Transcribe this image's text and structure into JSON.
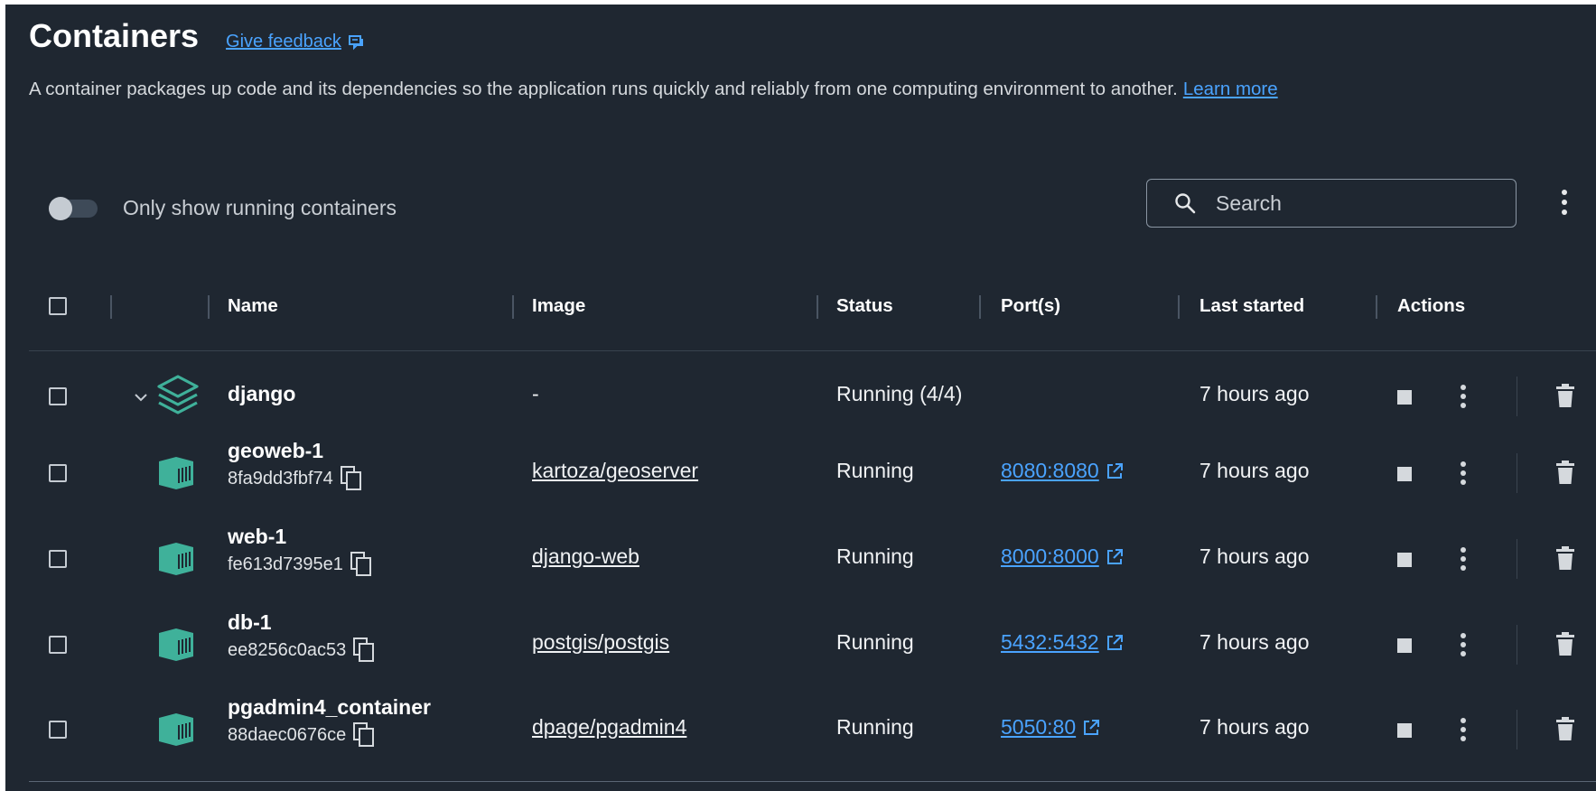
{
  "header": {
    "title": "Containers",
    "feedback_label": "Give feedback",
    "description": "A container packages up code and its dependencies so the application runs quickly and reliably from one computing environment to another.",
    "learn_more": "Learn more"
  },
  "filters": {
    "toggle_label": "Only show running containers",
    "toggle_on": false,
    "search_placeholder": "Search"
  },
  "columns": {
    "name": "Name",
    "image": "Image",
    "status": "Status",
    "ports": "Port(s)",
    "last_started": "Last started",
    "actions": "Actions"
  },
  "group": {
    "name": "django",
    "image": "-",
    "status": "Running (4/4)",
    "last_started": "7 hours ago"
  },
  "containers": [
    {
      "name": "geoweb-1",
      "id": "8fa9dd3fbf74",
      "image": "kartoza/geoserver",
      "status": "Running",
      "port": "8080:8080",
      "last_started": "7 hours ago"
    },
    {
      "name": "web-1",
      "id": "fe613d7395e1",
      "image": "django-web",
      "status": "Running",
      "port": "8000:8000",
      "last_started": "7 hours ago"
    },
    {
      "name": "db-1",
      "id": "ee8256c0ac53",
      "image": "postgis/postgis",
      "status": "Running",
      "port": "5432:5432",
      "last_started": "7 hours ago"
    },
    {
      "name": "pgadmin4_container",
      "id": "88daec0676ce",
      "image": "dpage/pgadmin4",
      "status": "Running",
      "port": "5050:80",
      "last_started": "7 hours ago"
    }
  ],
  "colors": {
    "background": "#1f2731",
    "link": "#4aa3ff",
    "container_icon": "#3fb19a"
  },
  "icons": {
    "feedback": "feedback-icon",
    "search": "search-icon",
    "more": "kebab-icon",
    "expand": "chevron-down-icon",
    "stack": "stack-icon",
    "container": "container-icon",
    "copy": "copy-icon",
    "external": "external-link-icon",
    "stop": "stop-icon",
    "delete": "trash-icon"
  }
}
